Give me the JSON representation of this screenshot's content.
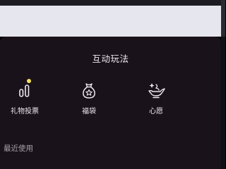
{
  "panel": {
    "title": "互动玩法"
  },
  "features": [
    {
      "label": "礼物投票",
      "icon": "bar-chart-icon",
      "has_badge": true
    },
    {
      "label": "福袋",
      "icon": "lucky-bag-icon",
      "has_badge": false
    },
    {
      "label": "心愿",
      "icon": "magic-lamp-icon",
      "has_badge": false
    }
  ],
  "recent": {
    "label": "最近使用"
  },
  "colors": {
    "panel_background": "#1a121a",
    "badge_dot": "#f6e15b",
    "text_primary": "#efe9f0",
    "text_secondary": "#a8a0ab"
  }
}
